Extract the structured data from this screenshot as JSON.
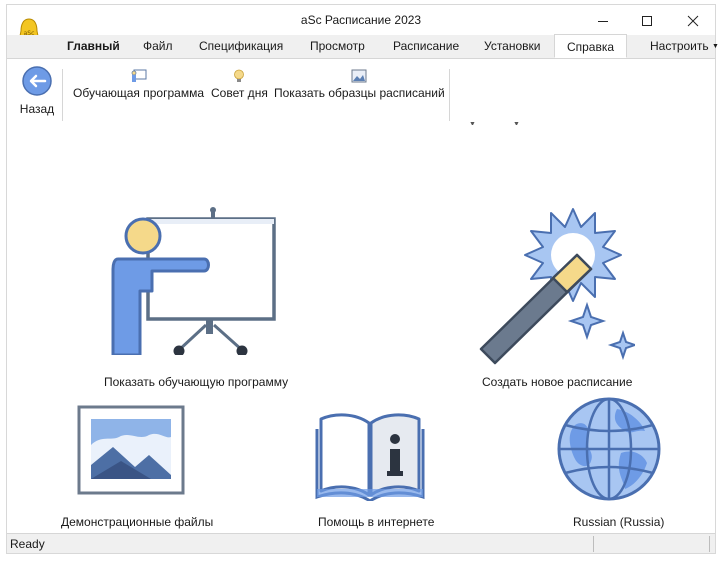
{
  "window": {
    "title": "aSc Расписание 2023",
    "minimize_icon": "minimize-icon",
    "maximize_icon": "maximize-icon",
    "close_icon": "close-icon"
  },
  "tabs": [
    {
      "label": "Главный"
    },
    {
      "label": "Файл"
    },
    {
      "label": "Спецификация"
    },
    {
      "label": "Просмотр"
    },
    {
      "label": "Расписание"
    },
    {
      "label": "Установки"
    },
    {
      "label": "Справка"
    },
    {
      "label": "Настроить"
    }
  ],
  "active_tab": "Справка",
  "ribbon": {
    "back_label": "Назад",
    "tutorial_label": "Обучающая программа",
    "tip_label": "Совет дня",
    "samples_label": "Показать образцы расписаний"
  },
  "content": {
    "tile_tutorial": "Показать обучающую программу",
    "tile_new_schedule": "Создать новое расписание",
    "tile_demo_files": "Демонстрационные файлы",
    "tile_help_online": "Помощь в интернете",
    "tile_language": "Russian (Russia)"
  },
  "status": {
    "text": "Ready"
  },
  "colors": {
    "icon_blue": "#6e9be6",
    "icon_outline": "#4a6fb0",
    "accent_yellow": "#f5d98a",
    "tab_bar": "#f0f0f0"
  }
}
